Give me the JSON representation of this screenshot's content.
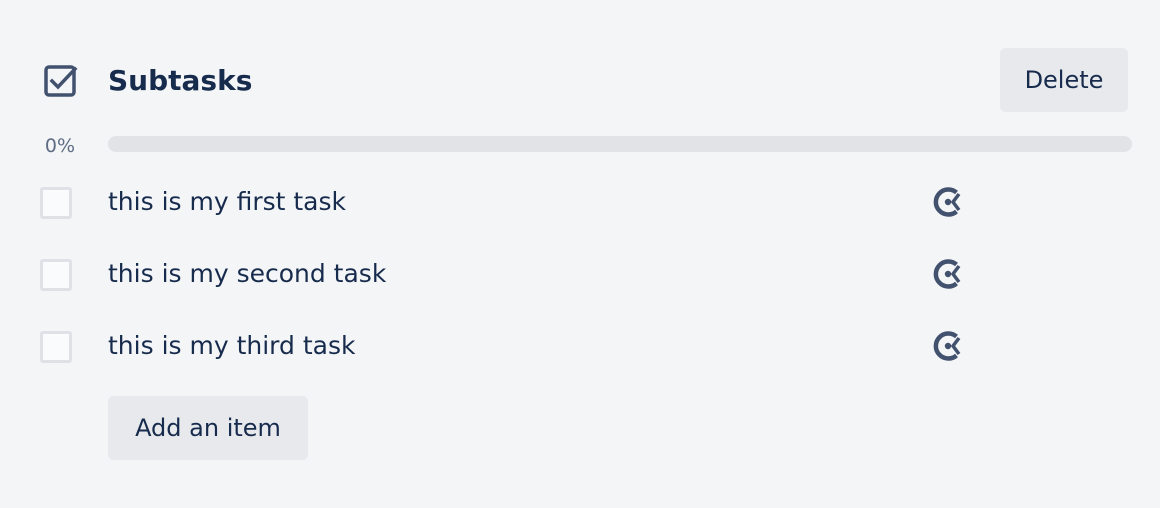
{
  "checklist": {
    "icon": "checkbox-checked-icon",
    "title": "Subtasks",
    "delete_label": "Delete",
    "progress": {
      "label": "0%",
      "percent": 0
    },
    "items": [
      {
        "text": "this is my first task",
        "checked": false,
        "action_icon": "due-date-clock-icon"
      },
      {
        "text": "this is my second task",
        "checked": false,
        "action_icon": "due-date-clock-icon"
      },
      {
        "text": "this is my third task",
        "checked": false,
        "action_icon": "due-date-clock-icon"
      }
    ],
    "add_item_label": "Add an item"
  },
  "colors": {
    "background": "#f4f5f7",
    "text": "#172b4d",
    "button_bg": "#e8e9ed",
    "progress_track": "#e2e3e6",
    "progress_fill": "#5aac44",
    "icon": "#42526e",
    "muted_text": "#5e6c84"
  }
}
